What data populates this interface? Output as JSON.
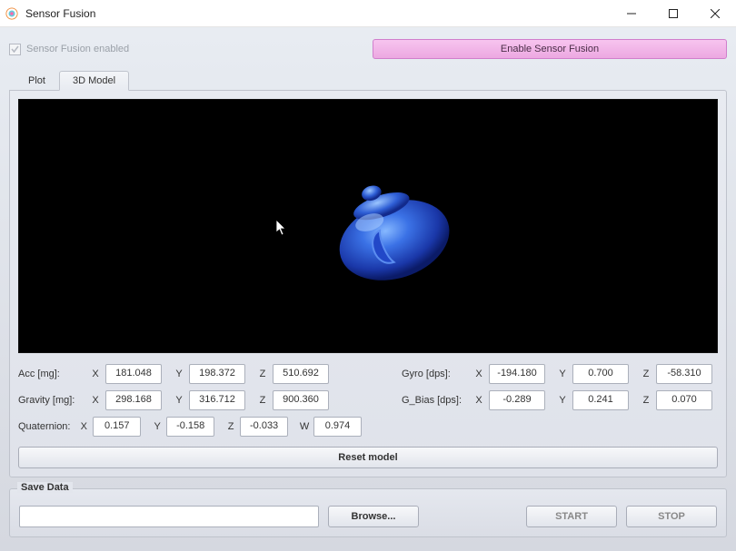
{
  "window": {
    "title": "Sensor Fusion"
  },
  "top": {
    "checkbox_label": "Sensor Fusion enabled",
    "enable_button": "Enable Sensor Fusion"
  },
  "tabs": {
    "plot": "Plot",
    "model": "3D Model"
  },
  "data": {
    "acc": {
      "label": "Acc [mg]:",
      "x": "181.048",
      "y": "198.372",
      "z": "510.692"
    },
    "gravity": {
      "label": "Gravity [mg]:",
      "x": "298.168",
      "y": "316.712",
      "z": "900.360"
    },
    "quat": {
      "label": "Quaternion:",
      "x": "0.157",
      "y": "-0.158",
      "z": "-0.033",
      "w": "0.974"
    },
    "gyro": {
      "label": "Gyro [dps]:",
      "x": "-194.180",
      "y": "0.700",
      "z": "-58.310"
    },
    "gbias": {
      "label": "G_Bias [dps]:",
      "x": "-0.289",
      "y": "0.241",
      "z": "0.070"
    },
    "axis": {
      "x": "X",
      "y": "Y",
      "z": "Z",
      "w": "W"
    }
  },
  "buttons": {
    "reset": "Reset model",
    "browse": "Browse...",
    "start": "START",
    "stop": "STOP"
  },
  "save": {
    "group_label": "Save Data",
    "path": ""
  }
}
